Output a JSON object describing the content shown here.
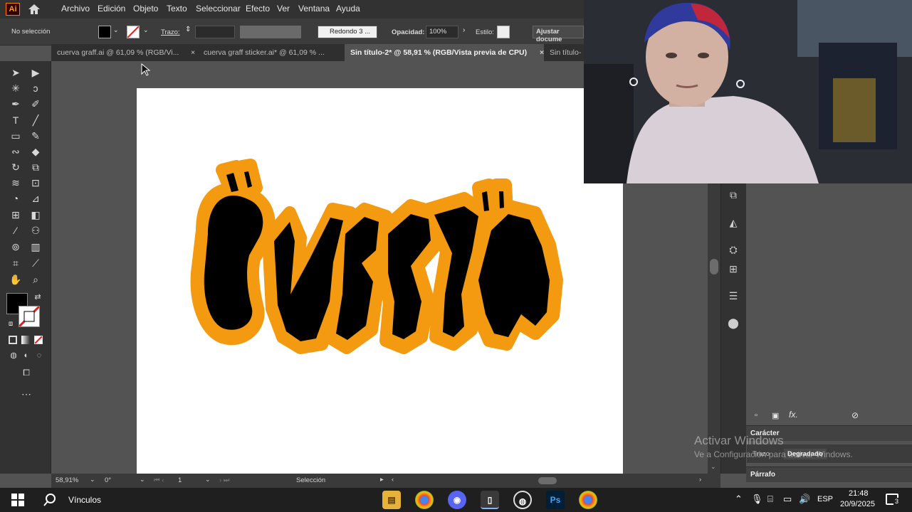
{
  "app": {
    "logo": "Ai"
  },
  "menu": [
    "Archivo",
    "Edición",
    "Objeto",
    "Texto",
    "Seleccionar",
    "Efecto",
    "Ver",
    "Ventana",
    "Ayuda"
  ],
  "control": {
    "selection_label": "No selección",
    "stroke_label": "Trazo:",
    "brush_value": "Redondo 3 ...",
    "opacity_label": "Opacidad:",
    "opacity_value": "100%",
    "style_label": "Estilo:",
    "adjust_button": "Ajustar docume"
  },
  "tabs": [
    {
      "label": "cuerva graff.ai @ 61,09 % (RGB/Vi...",
      "active": false
    },
    {
      "label": "cuerva graff sticker.ai* @ 61,09 % ...",
      "active": false
    },
    {
      "label": "Sin título-2* @ 58,91 % (RGB/Vista previa de CPU)",
      "active": true
    },
    {
      "label": "Sin título-",
      "active": false
    }
  ],
  "status": {
    "zoom": "58,91%",
    "rotation": "0°",
    "artboard_number": "1",
    "tool_name": "Selección"
  },
  "panels": {
    "caracter": "Carácter",
    "trazo": "Trazo",
    "degradado": "Degradado",
    "parrafo": "Párrafo"
  },
  "watermark": {
    "line1": "Activar Windows",
    "line2": "Ve a Configuración para activar Windows."
  },
  "taskbar": {
    "search_label": "Vínculos",
    "language": "ESP",
    "time": "21:48",
    "date": "20/9/2025",
    "notification_count": "3"
  },
  "artwork": {
    "text": "CUERVA",
    "fill_color": "#000000",
    "outline_color": "#f39a10"
  },
  "colors": {
    "accent_orange": "#f39a10",
    "ui_dark": "#323232",
    "ui_mid": "#535353"
  }
}
